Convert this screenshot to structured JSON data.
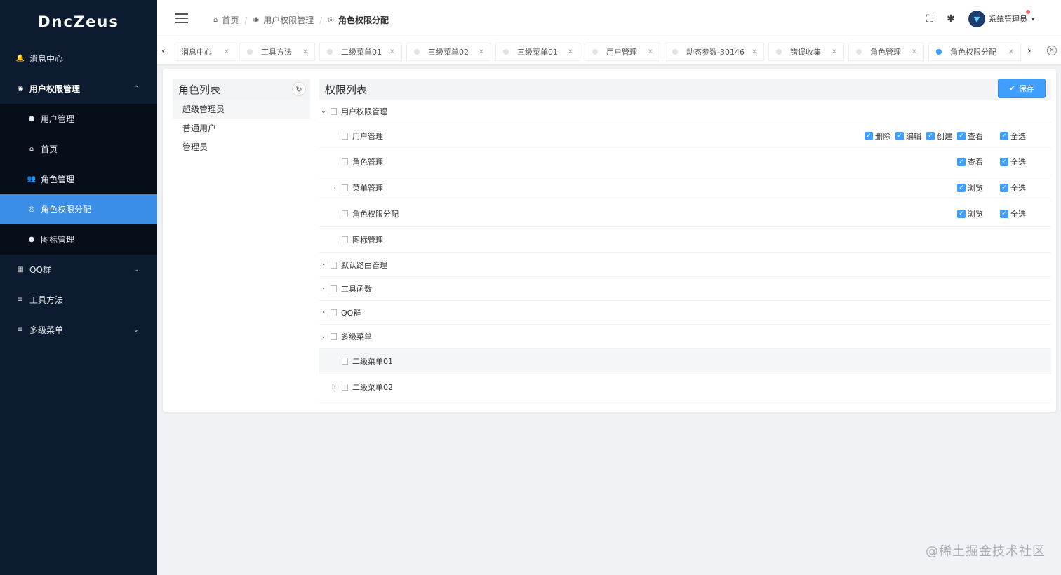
{
  "app": {
    "logo": "DncZeus"
  },
  "sidebar": {
    "items": [
      {
        "label": "消息中心",
        "icon": "bell-icon",
        "glyph": "🔔"
      },
      {
        "label": "用户权限管理",
        "icon": "shield-icon",
        "glyph": "◉",
        "arrow": "⌃"
      },
      {
        "label": "QQ群",
        "icon": "grid-icon",
        "glyph": "▦",
        "arrow": "⌄"
      },
      {
        "label": "工具方法",
        "icon": "list-icon",
        "glyph": "≡"
      },
      {
        "label": "多级菜单",
        "icon": "list-icon",
        "glyph": "≡",
        "arrow": "⌄"
      }
    ],
    "submenu": [
      {
        "label": "用户管理",
        "icon": "user-icon",
        "glyph": "●"
      },
      {
        "label": "首页",
        "icon": "home-icon",
        "glyph": "⌂"
      },
      {
        "label": "角色管理",
        "icon": "users-icon",
        "glyph": "👥"
      },
      {
        "label": "角色权限分配",
        "icon": "settings-icon",
        "glyph": "◎"
      },
      {
        "label": "图标管理",
        "icon": "circle-icon",
        "glyph": "●"
      }
    ]
  },
  "header": {
    "breadcrumb": [
      {
        "label": "首页",
        "glyph": "⌂"
      },
      {
        "label": "用户权限管理",
        "glyph": "◉"
      },
      {
        "label": "角色权限分配",
        "glyph": "◎"
      }
    ],
    "username": "系统管理员",
    "fullscreen_glyph": "⛶",
    "bug_glyph": "✱",
    "caret": "▾"
  },
  "tags": {
    "left_arrow": "‹",
    "right_arrow": "›",
    "close_all": "×",
    "items": [
      {
        "label": "消息中心"
      },
      {
        "label": "工具方法"
      },
      {
        "label": "二级菜单01"
      },
      {
        "label": "三级菜单02"
      },
      {
        "label": "三级菜单01"
      },
      {
        "label": "用户管理"
      },
      {
        "label": "动态参数-30146"
      },
      {
        "label": "错误收集"
      },
      {
        "label": "角色管理"
      },
      {
        "label": "角色权限分配",
        "active": true
      }
    ]
  },
  "role_panel": {
    "title": "角色列表",
    "refresh_glyph": "↻",
    "roles": [
      "超级管理员",
      "普通用户",
      "管理员"
    ]
  },
  "perm_panel": {
    "title": "权限列表",
    "save_label": "保存",
    "save_glyph": "✔",
    "check_glyph": "✓",
    "tree": [
      {
        "label": "用户权限管理",
        "expander": "⌄",
        "level": 0
      },
      {
        "label": "用户管理",
        "expander": "",
        "level": 1,
        "checks": [
          "删除",
          "编辑",
          "创建",
          "查看"
        ],
        "all": "全选"
      },
      {
        "label": "角色管理",
        "expander": "",
        "level": 1,
        "checks": [
          "查看"
        ],
        "all": "全选"
      },
      {
        "label": "菜单管理",
        "expander": "›",
        "level": 1,
        "checks": [
          "浏览"
        ],
        "all": "全选"
      },
      {
        "label": "角色权限分配",
        "expander": "",
        "level": 1,
        "checks": [
          "浏览"
        ],
        "all": "全选"
      },
      {
        "label": "图标管理",
        "expander": "",
        "level": 1
      },
      {
        "label": "默认路由管理",
        "expander": "›",
        "level": 0
      },
      {
        "label": "工具函数",
        "expander": "›",
        "level": 0
      },
      {
        "label": "QQ群",
        "expander": "›",
        "level": 0
      },
      {
        "label": "多级菜单",
        "expander": "⌄",
        "level": 0
      },
      {
        "label": "二级菜单01",
        "expander": "",
        "level": 1,
        "highlight": true
      },
      {
        "label": "二级菜单02",
        "expander": "›",
        "level": 1
      }
    ]
  },
  "watermark": "@稀土掘金技术社区",
  "colors": {
    "sidebar_bg": "#0c1b2f",
    "active": "#409eff"
  }
}
